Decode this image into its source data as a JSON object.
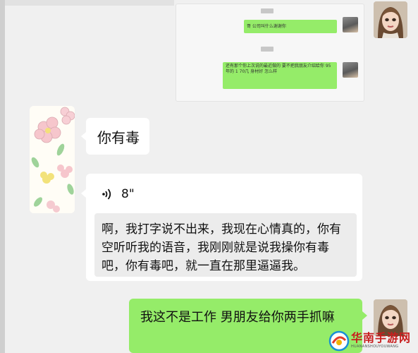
{
  "screenshot_card": {
    "messages": [
      {
        "text": "哥 公司叫什么谢谢你"
      },
      {
        "text": "还有那个你上次说的最近做的 要不把我朋友介绍给你 95年的 1 70几 身材好 怎么样"
      }
    ]
  },
  "messages": {
    "received_short": "你有毒",
    "voice_duration": "8\"",
    "voice_transcript": "啊，我打字说不出来，我现在心情真的，你有空听听我的语音，我刚刚就是说我操你有毒吧，你有毒吧，就一直在那里逼逼我。",
    "sent": "我这不是工作 男朋友给你两手抓嘛"
  },
  "watermark": {
    "main": "华南手游网",
    "sub": "HUANANSHOUYOUWANG"
  },
  "colors": {
    "sent_bubble": "#95ec69",
    "received_bubble": "#ffffff",
    "background": "#f0f0f0",
    "watermark_red": "#c81e1e"
  },
  "icons": {
    "voice": "voice-wave-icon",
    "avatar_self": "cartoon-girl-avatar",
    "avatar_other": "floral-avatar"
  }
}
